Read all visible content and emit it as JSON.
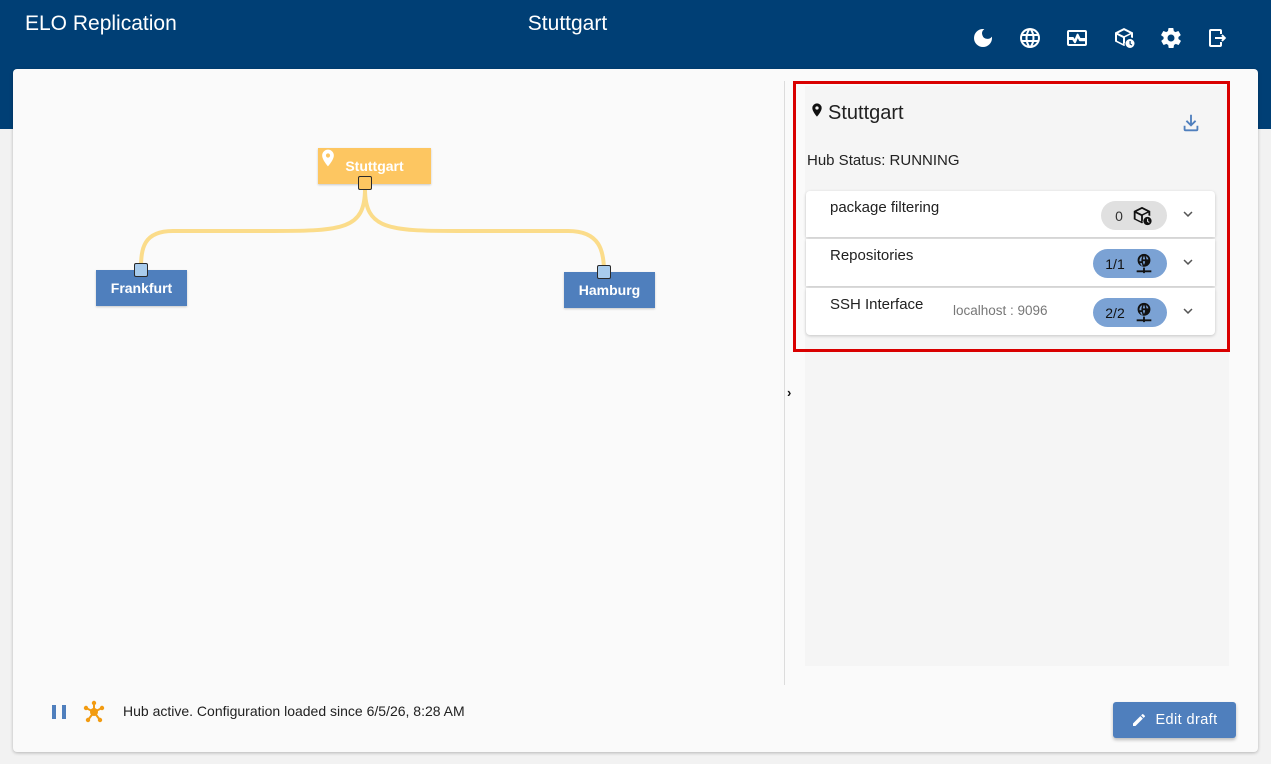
{
  "header": {
    "app_title": "ELO Replication",
    "center_title": "Stuttgart",
    "icons": [
      "dark-mode-icon",
      "language-globe-icon",
      "monitoring-icon",
      "package-icon",
      "settings-gear-icon",
      "logout-icon"
    ]
  },
  "graph": {
    "hub_node": {
      "label": "Stuttgart",
      "color": "#fdc661"
    },
    "nodes": [
      {
        "label": "Frankfurt",
        "color": "#4f7fbd"
      },
      {
        "label": "Hamburg",
        "color": "#4f7fbd"
      }
    ],
    "edge_color": "#fbdc8a"
  },
  "panel": {
    "title": "Stuttgart",
    "hub_status": "Hub Status: RUNNING",
    "sections": [
      {
        "label": "package filtering",
        "sub": "",
        "count": "0",
        "icon": "package-clock-icon"
      },
      {
        "label": "Repositories",
        "sub": "",
        "count": "1/1",
        "icon": "network-globe-icon"
      },
      {
        "label": "SSH Interface",
        "sub": "localhost : 9096",
        "count": "2/2",
        "icon": "network-globe-icon"
      }
    ],
    "highlight_color": "#d90000"
  },
  "footer": {
    "status_text": "Hub active. Configuration loaded since 6/5/26, 8:28 AM",
    "edit_button": "Edit draft"
  }
}
